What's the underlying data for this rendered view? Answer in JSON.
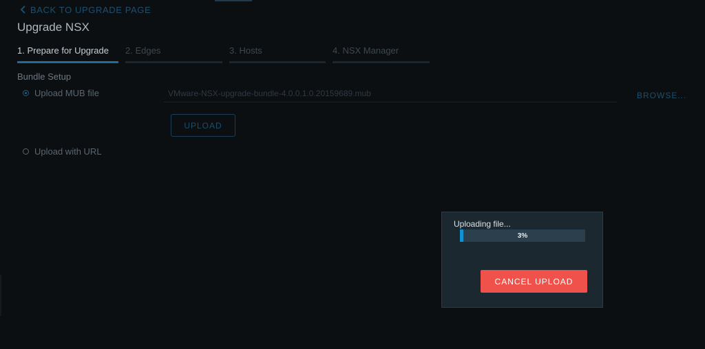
{
  "nav": {
    "back_label": "BACK TO UPGRADE PAGE"
  },
  "page": {
    "title": "Upgrade NSX"
  },
  "tabs": [
    {
      "label": "1. Prepare for Upgrade",
      "active": true
    },
    {
      "label": "2. Edges",
      "active": false
    },
    {
      "label": "3. Hosts",
      "active": false
    },
    {
      "label": "4. NSX Manager",
      "active": false
    }
  ],
  "bundle_setup": {
    "title": "Bundle Setup",
    "options": [
      {
        "label": "Upload MUB file",
        "checked": true
      },
      {
        "label": "Upload with URL",
        "checked": false
      }
    ],
    "file_value": "VMware-NSX-upgrade-bundle-4.0.0.1.0.20159689.mub",
    "browse_label": "BROWSE...",
    "upload_label": "UPLOAD"
  },
  "upload_dialog": {
    "title": "Uploading file...",
    "progress_percent": 3,
    "progress_label": "3%",
    "cancel_label": "CANCEL UPLOAD"
  },
  "colors": {
    "accent": "#0f93d2",
    "danger": "#f0514a",
    "background": "#0b0f12"
  },
  "icons": {
    "back": "chevron-left-icon"
  }
}
